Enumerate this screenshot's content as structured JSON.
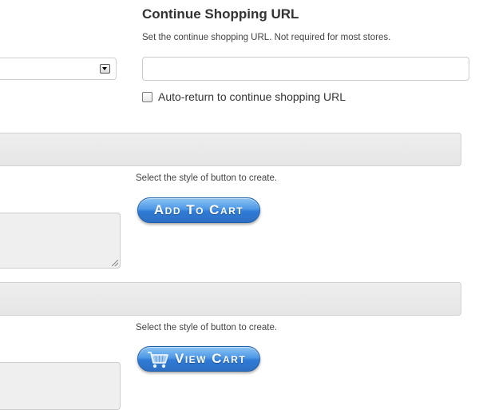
{
  "continue_shopping": {
    "title": "Continue Shopping URL",
    "help": "Set the continue shopping URL. Not required for most stores.",
    "url_value": "",
    "url_placeholder": "",
    "auto_return_label": "Auto-return to continue shopping URL",
    "auto_return_checked": false
  },
  "add_to_cart_section": {
    "help": "Select the style of button to create.",
    "button_label": "Add To Cart"
  },
  "view_cart_section": {
    "help": "Select the style of button to create.",
    "button_label": "View Cart",
    "button_icon": "shopping-cart-icon"
  },
  "colors": {
    "button_blue": "#3a86dc",
    "field_gray": "#e9e9e9",
    "text": "#333333"
  }
}
